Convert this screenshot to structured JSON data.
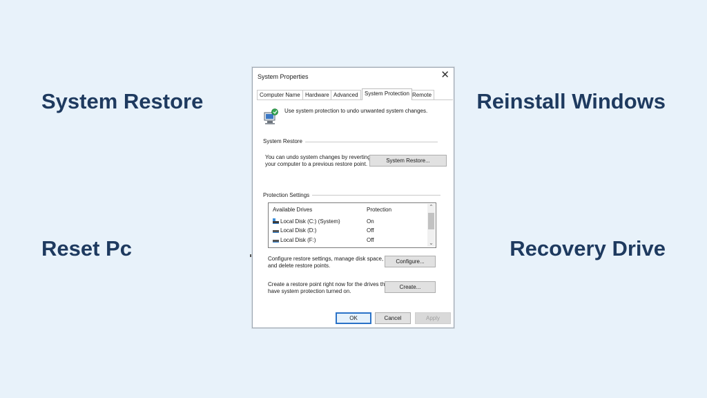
{
  "labels": {
    "top_left": "System Restore",
    "top_right": "Reinstall Windows",
    "bottom_left": "Reset Pc",
    "bottom_right": "Recovery Drive"
  },
  "dialog": {
    "title": "System Properties",
    "close_glyph": "✕",
    "tabs": [
      {
        "label": "Computer Name",
        "active": false
      },
      {
        "label": "Hardware",
        "active": false
      },
      {
        "label": "Advanced",
        "active": false
      },
      {
        "label": "System Protection",
        "active": true
      },
      {
        "label": "Remote",
        "active": false
      }
    ],
    "intro_text": "Use system protection to undo unwanted system changes.",
    "system_restore": {
      "group_title": "System Restore",
      "description_line1": "You can undo system changes by reverting",
      "description_line2": "your computer to a previous restore point.",
      "button_label": "System Restore..."
    },
    "protection": {
      "group_title": "Protection Settings",
      "col_drives": "Available Drives",
      "col_protection": "Protection",
      "drives": [
        {
          "name": "Local Disk (C:) (System)",
          "protection": "On",
          "icon": "system-drive-icon"
        },
        {
          "name": "Local Disk (D:)",
          "protection": "Off",
          "icon": "drive-icon"
        },
        {
          "name": "Local Disk (F:)",
          "protection": "Off",
          "icon": "drive-icon"
        }
      ],
      "configure_line1": "Configure restore settings, manage disk space,",
      "configure_line2": "and delete restore points.",
      "configure_button": "Configure...",
      "create_line1": "Create a restore point right now for the drives that",
      "create_line2": "have system protection turned on.",
      "create_button": "Create..."
    },
    "buttons": {
      "ok": "OK",
      "cancel": "Cancel",
      "apply": "Apply"
    },
    "scroll_up_glyph": "⌃",
    "scroll_down_glyph": "⌄"
  },
  "colors": {
    "background": "#e8f2fa",
    "label_text": "#1e3a5f",
    "default_button_border": "#2a72c7"
  }
}
